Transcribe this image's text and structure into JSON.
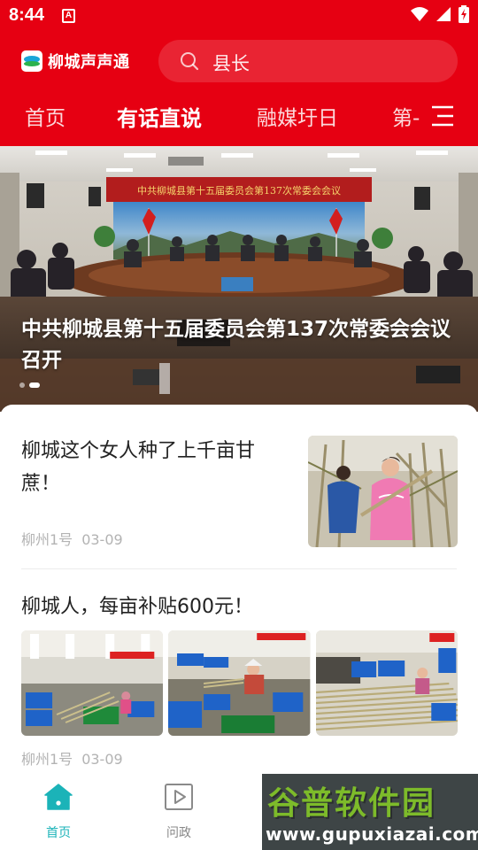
{
  "status_bar": {
    "time": "8:44",
    "notification_badge": "A",
    "icons": [
      "wifi-icon",
      "signal-icon",
      "battery-charging-icon"
    ]
  },
  "app": {
    "name": "柳城声声通",
    "brand_color": "#e60012",
    "accent_color": "#1bb3b8"
  },
  "search": {
    "placeholder": "县长"
  },
  "tabs": [
    {
      "label": "首页",
      "active": false
    },
    {
      "label": "有话直说",
      "active": true
    },
    {
      "label": "融媒圩日",
      "active": false
    },
    {
      "label": "第-",
      "active": false
    }
  ],
  "banner": {
    "title": "中共柳城县第十五届委员会第137次常委会会议召开",
    "backdrop_text": "中共柳城县第十五届委员会第137次常委会会议",
    "slide_count": 2,
    "active_slide": 2
  },
  "feed": [
    {
      "title": "柳城这个女人种了上千亩甘蔗！",
      "source": "柳州1号",
      "date": "03-09",
      "layout": "single-thumb"
    },
    {
      "title": "柳城人，每亩补贴600元！",
      "source": "柳州1号",
      "date": "03-09",
      "layout": "three-thumbs"
    }
  ],
  "bottom_nav": [
    {
      "label": "首页",
      "icon": "home-icon",
      "active": true
    },
    {
      "label": "问政",
      "icon": "play-icon",
      "active": false
    }
  ],
  "watermark": {
    "title": "谷普软件园",
    "url": "www.gupuxiazai.com"
  }
}
